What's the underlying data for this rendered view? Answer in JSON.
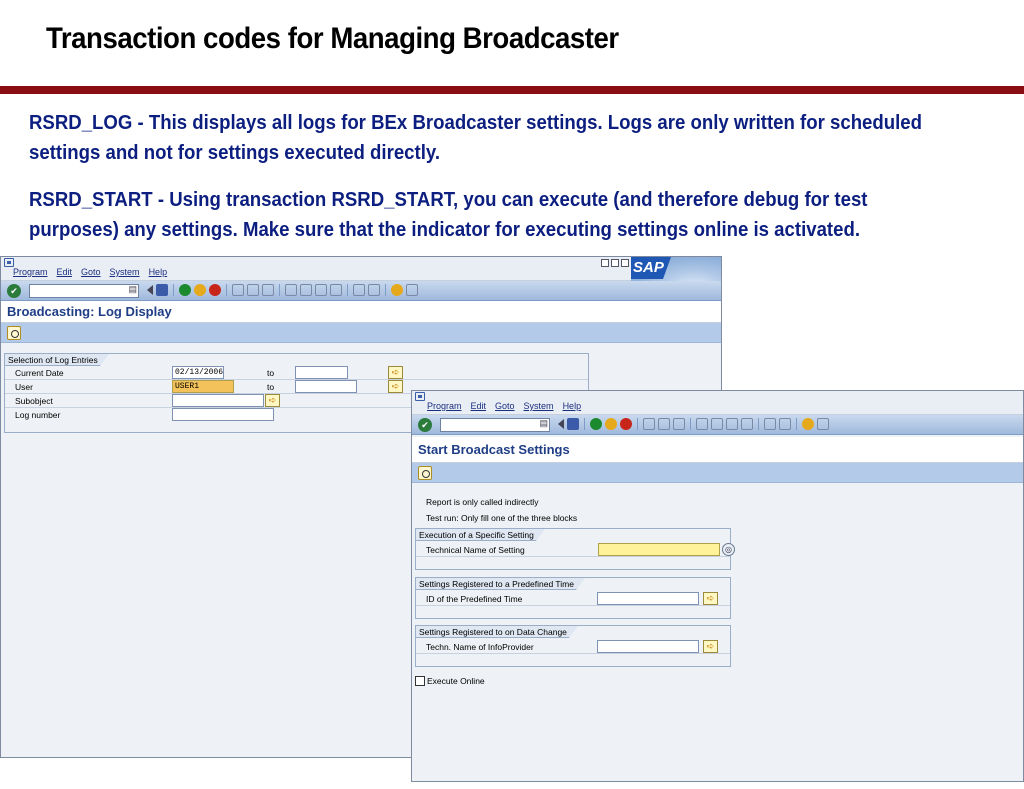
{
  "slide": {
    "title": "Transaction codes for Managing Broadcaster",
    "bullet1": "RSRD_LOG - This displays all logs for BEx Broadcaster settings. Logs are only written for scheduled settings and not for settings executed directly.",
    "bullet2": "RSRD_START - Using transaction RSRD_START, you can execute (and therefore debug for test purposes) any settings. Make sure that the indicator for executing settings online is activated."
  },
  "menu": {
    "program": "Program",
    "edit": "Edit",
    "goto": "Goto",
    "system": "System",
    "help": "Help"
  },
  "logo_text": "SAP",
  "log_window": {
    "title": "Broadcasting: Log Display",
    "group_title": "Selection of Log Entries",
    "rows": [
      {
        "label": "Current Date",
        "value": "02/13/2006",
        "to": "to"
      },
      {
        "label": "User",
        "value": "USER1",
        "to": "to"
      },
      {
        "label": "Subobject",
        "value": ""
      },
      {
        "label": "Log number",
        "value": ""
      }
    ]
  },
  "start_window": {
    "title": "Start Broadcast Settings",
    "text1": "Report is only called indirectly",
    "text2": "Test run: Only fill one of the three blocks",
    "group1": {
      "title": "Execution of a Specific Setting",
      "label": "Technical Name of Setting"
    },
    "group2": {
      "title": "Settings Registered to a Predefined Time",
      "label": "ID of the Predefined Time"
    },
    "group3": {
      "title": "Settings Registered to on Data Change",
      "label": "Techn. Name of InfoProvider"
    },
    "checkbox_label": "Execute Online"
  }
}
